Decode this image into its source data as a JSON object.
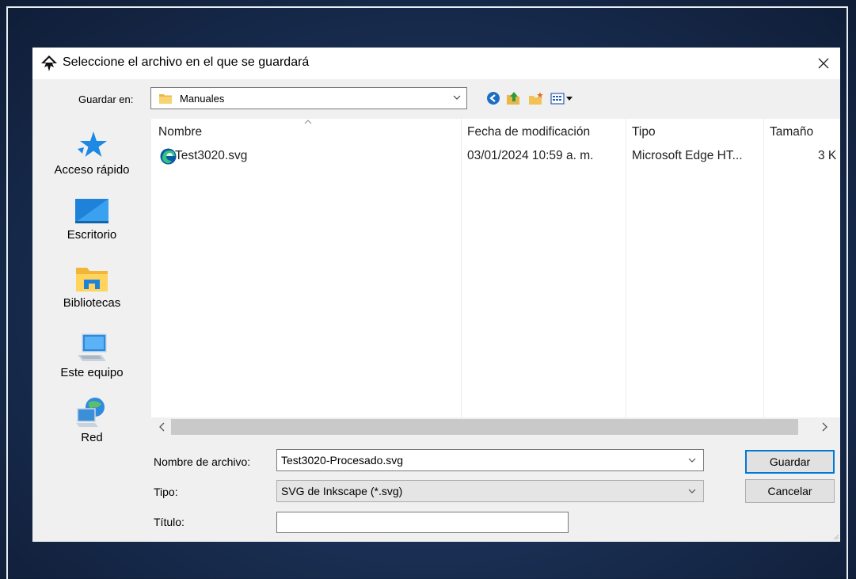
{
  "dialog": {
    "title": "Seleccione el archivo en el que se guardará",
    "app_icon": "inkscape-icon",
    "close_icon": "close-icon"
  },
  "location": {
    "label": "Guardar en:",
    "value": "Manuales",
    "folder_icon": "folder-icon"
  },
  "toolbar": {
    "icons": [
      "back-icon",
      "up-folder-icon",
      "new-folder-icon",
      "view-menu-icon"
    ]
  },
  "places": [
    {
      "label": "Acceso rápido",
      "icon": "star-icon"
    },
    {
      "label": "Escritorio",
      "icon": "desktop-icon"
    },
    {
      "label": "Bibliotecas",
      "icon": "libraries-icon"
    },
    {
      "label": "Este equipo",
      "icon": "computer-icon"
    },
    {
      "label": "Red",
      "icon": "network-icon"
    }
  ],
  "columns": [
    "Nombre",
    "Fecha de modificación",
    "Tipo",
    "Tamaño"
  ],
  "files": [
    {
      "name": "Test3020.svg",
      "modified": "03/01/2024 10:59 a. m.",
      "type": "Microsoft Edge HT...",
      "size": "3 K",
      "icon": "edge-icon"
    }
  ],
  "form": {
    "filename_label": "Nombre de archivo:",
    "filename_value": "Test3020-Procesado.svg",
    "type_label": "Tipo:",
    "type_value": "SVG de Inkscape (*.svg)",
    "title_label": "Título:",
    "title_value": ""
  },
  "buttons": {
    "save": "Guardar",
    "cancel": "Cancelar"
  },
  "colors": {
    "background": "#1b3157",
    "dialog": "#f0f0f0",
    "accent": "#0078d7"
  }
}
